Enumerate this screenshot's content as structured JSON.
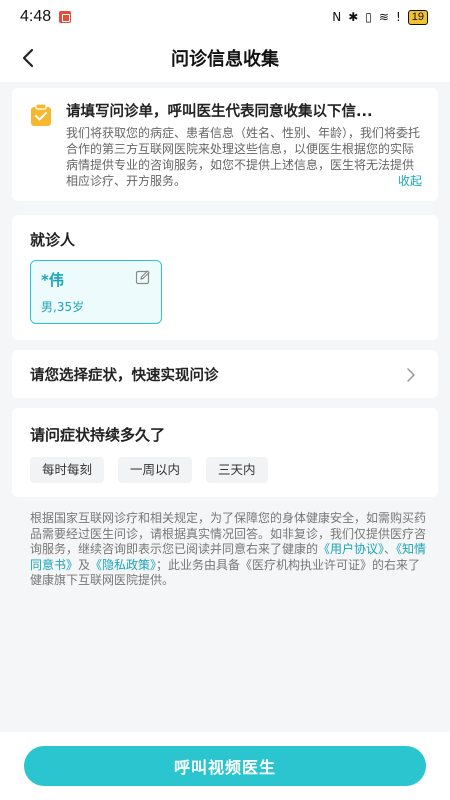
{
  "statusbar": {
    "time": "4:48",
    "nfc": "N",
    "bluetooth": "✱",
    "vibrate": "▯",
    "wifi": "≋",
    "alert": "!",
    "battery": "19"
  },
  "nav": {
    "title": "问诊信息收集"
  },
  "notice": {
    "title": "请填写问诊单，呼叫医生代表同意收集以下信...",
    "body": "我们将获取您的病症、患者信息（姓名、性别、年龄），我们将委托合作的第三方互联网医院来处理这些信息，以便医生根据您的实际病情提供专业的咨询服务，如您不提供上述信息，医生将无法提供相应诊疗、开方服务。",
    "collapse": "收起"
  },
  "patient": {
    "section_title": "就诊人",
    "name": "*伟",
    "meta": "男,35岁"
  },
  "symptom": {
    "label": "请您选择症状，快速实现问诊"
  },
  "duration": {
    "title": "请问症状持续多久了",
    "options": [
      "每时每刻",
      "一周以内",
      "三天内"
    ]
  },
  "disclaimer": {
    "text1": "根据国家互联网诊疗和相关规定，为了保障您的身体健康安全，如需购买药品需要经过医生问诊，请根据真实情况回答。如非复诊，我们仅提供医疗咨询服务，继续咨询即表示您已阅读并同意右来了健康的",
    "link1": "《用户协议》",
    "sep1": "、",
    "link2": "《知情同意书》",
    "sep2": "及",
    "link3": "《隐私政策》",
    "text2": "；此业务由具备《医疗机构执业许可证》的右来了健康旗下互联网医院提供。"
  },
  "bottom": {
    "call_label": "呼叫视频医生"
  },
  "colors": {
    "accent": "#2bc5cf",
    "link": "#1aa5b8"
  }
}
